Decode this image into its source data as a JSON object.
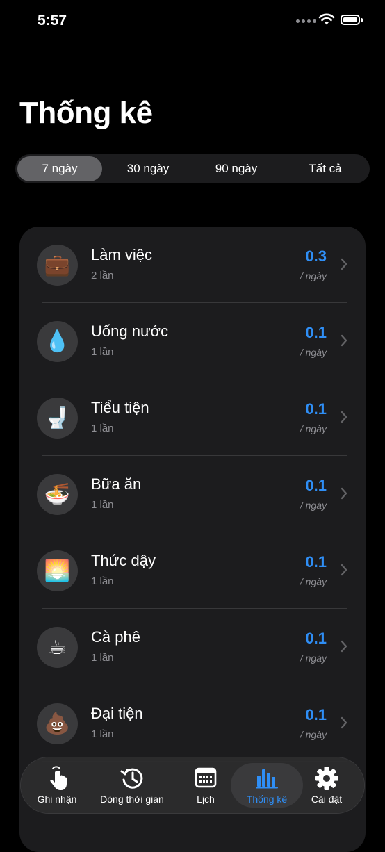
{
  "status": {
    "time": "5:57"
  },
  "title": "Thống kê",
  "segments": [
    {
      "label": "7 ngày",
      "active": true
    },
    {
      "label": "30 ngày",
      "active": false
    },
    {
      "label": "90 ngày",
      "active": false
    },
    {
      "label": "Tất cả",
      "active": false
    }
  ],
  "items": [
    {
      "icon": "💼",
      "icon_name": "briefcase-icon",
      "title": "Làm việc",
      "count": "2 lần",
      "value": "0.3",
      "unit": "/ ngày"
    },
    {
      "icon": "💧",
      "icon_name": "water-drop-icon",
      "title": "Uống nước",
      "count": "1 lần",
      "value": "0.1",
      "unit": "/ ngày"
    },
    {
      "icon": "🚽",
      "icon_name": "toilet-icon",
      "title": "Tiểu tiện",
      "count": "1 lần",
      "value": "0.1",
      "unit": "/ ngày"
    },
    {
      "icon": "🍜",
      "icon_name": "noodle-bowl-icon",
      "title": "Bữa ăn",
      "count": "1 lần",
      "value": "0.1",
      "unit": "/ ngày"
    },
    {
      "icon": "🌅",
      "icon_name": "sunrise-icon",
      "title": "Thức dậy",
      "count": "1 lần",
      "value": "0.1",
      "unit": "/ ngày"
    },
    {
      "icon": "☕",
      "icon_name": "coffee-icon",
      "title": "Cà phê",
      "count": "1 lần",
      "value": "0.1",
      "unit": "/ ngày"
    },
    {
      "icon": "💩",
      "icon_name": "poop-icon",
      "title": "Đại tiện",
      "count": "1 lần",
      "value": "0.1",
      "unit": "/ ngày"
    }
  ],
  "tabs": [
    {
      "label": "Ghi nhận",
      "icon_name": "hand-tap-icon",
      "active": false
    },
    {
      "label": "Dòng thời gian",
      "icon_name": "history-clock-icon",
      "active": false
    },
    {
      "label": "Lịch",
      "icon_name": "calendar-icon",
      "active": false
    },
    {
      "label": "Thống kê",
      "icon_name": "bar-chart-icon",
      "active": true
    },
    {
      "label": "Cài đặt",
      "icon_name": "gear-icon",
      "active": false
    }
  ],
  "colors": {
    "accent": "#2f8ef5",
    "background": "#000000",
    "card": "#1c1c1e"
  }
}
